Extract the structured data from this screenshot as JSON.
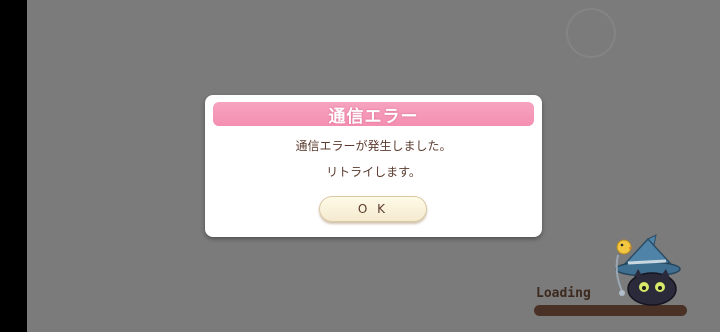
{
  "dialog": {
    "title": "通信エラー",
    "message_line1": "通信エラーが発生しました。",
    "message_line2": "リトライします。",
    "ok_label": "O K"
  },
  "loading": {
    "label": "Loading"
  },
  "colors": {
    "header_pink": "#f48fb1",
    "text_brown": "#5a3b2e",
    "overlay_gray": "#7b7b7b",
    "loading_bar": "#4a3126"
  },
  "icons": {
    "mascot": "black-cat-wizard-icon"
  }
}
